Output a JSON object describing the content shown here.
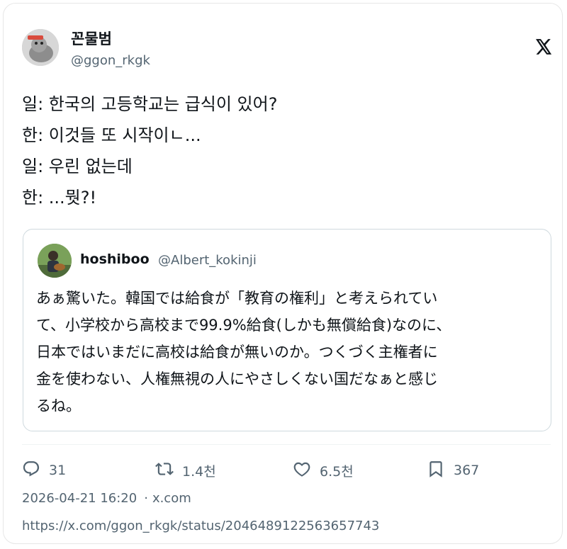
{
  "tweet": {
    "author_name": "꼰물범",
    "author_handle": "@ggon_rkgk",
    "body_lines": [
      "일: 한국의 고등학교는 급식이 있어?",
      "한: 이것들 또 시작이ㄴ...",
      "일: 우린 없는데",
      "한: ...뭣?!"
    ]
  },
  "quote": {
    "author_name": "hoshiboo",
    "author_handle": "@Albert_kokinji",
    "text_lines": [
      "あぁ驚いた。韓国では給食が「教育の権利」と考えられてい",
      "て、小学校から高校まで99.9%給食(しかも無償給食)なのに、",
      "日本ではいまだに高校は給食が無いのか。つくづく主権者に",
      "金を使わない、人権無視の人にやさしくない国だなぁと感じ",
      "るね。"
    ]
  },
  "actions": {
    "reply_count": "31",
    "retweet_count": "1.4천",
    "like_count": "6.5천",
    "bookmark_count": "367"
  },
  "meta": {
    "timestamp": "2026-04-21 16:20",
    "separator": "·",
    "source": "x.com",
    "url": "https://x.com/ggon_rkgk/status/2046489122563657743"
  },
  "icons": {
    "brand": "x-logo-icon",
    "reply": "reply-icon",
    "retweet": "retweet-icon",
    "like": "heart-icon",
    "bookmark": "bookmark-icon"
  }
}
